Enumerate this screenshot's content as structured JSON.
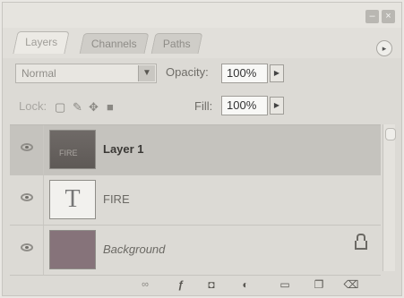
{
  "tabs": [
    {
      "label": "Layers",
      "active": true
    },
    {
      "label": "Channels",
      "active": false
    },
    {
      "label": "Paths",
      "active": false
    }
  ],
  "blend_mode": {
    "value": "Normal"
  },
  "opacity": {
    "label": "Opacity:",
    "value": "100%"
  },
  "lock": {
    "label": "Lock:"
  },
  "fill": {
    "label": "Fill:",
    "value": "100%"
  },
  "layers": [
    {
      "name": "Layer 1",
      "thumb_text": "FIRE",
      "selected": true
    },
    {
      "name": "FIRE",
      "thumb_glyph": "T",
      "selected": false
    },
    {
      "name": "Background",
      "locked": true,
      "selected": false
    }
  ],
  "colors": {
    "panel": "#dcdad5",
    "selected_row": "#c5c3be",
    "background_thumb": "#86737a"
  },
  "icons": [
    "link-icon",
    "fx-icon",
    "mask-icon",
    "adjustment-icon",
    "folder-icon",
    "new-layer-icon",
    "trash-icon"
  ]
}
